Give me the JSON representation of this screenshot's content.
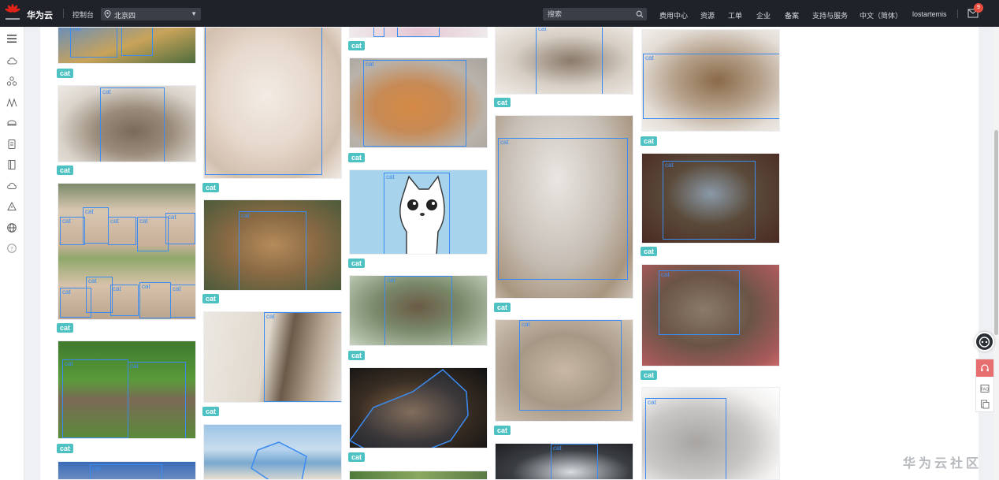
{
  "header": {
    "brand": "华为云",
    "console": "控制台",
    "region": "北京四",
    "search_placeholder": "搜索",
    "nav": [
      "费用中心",
      "资源",
      "工单",
      "企业",
      "备案",
      "支持与服务",
      "中文（简体）",
      "lostartemis"
    ],
    "notification_count": "9"
  },
  "sidebar": {
    "icons": [
      "menu-icon",
      "cloud-icon",
      "cluster-icon",
      "network-icon",
      "storage-icon",
      "document-icon",
      "book-icon",
      "cloud-outline-icon",
      "alert-icon",
      "globe-icon",
      "help-icon"
    ]
  },
  "gallery": {
    "label": "cat",
    "box_label": "cat"
  },
  "colors": {
    "topbar": "#1f2329",
    "tag": "#4ec2c2",
    "bbox": "#3b8cf2",
    "badge": "#e84d3d"
  },
  "watermark": "华为云社区"
}
